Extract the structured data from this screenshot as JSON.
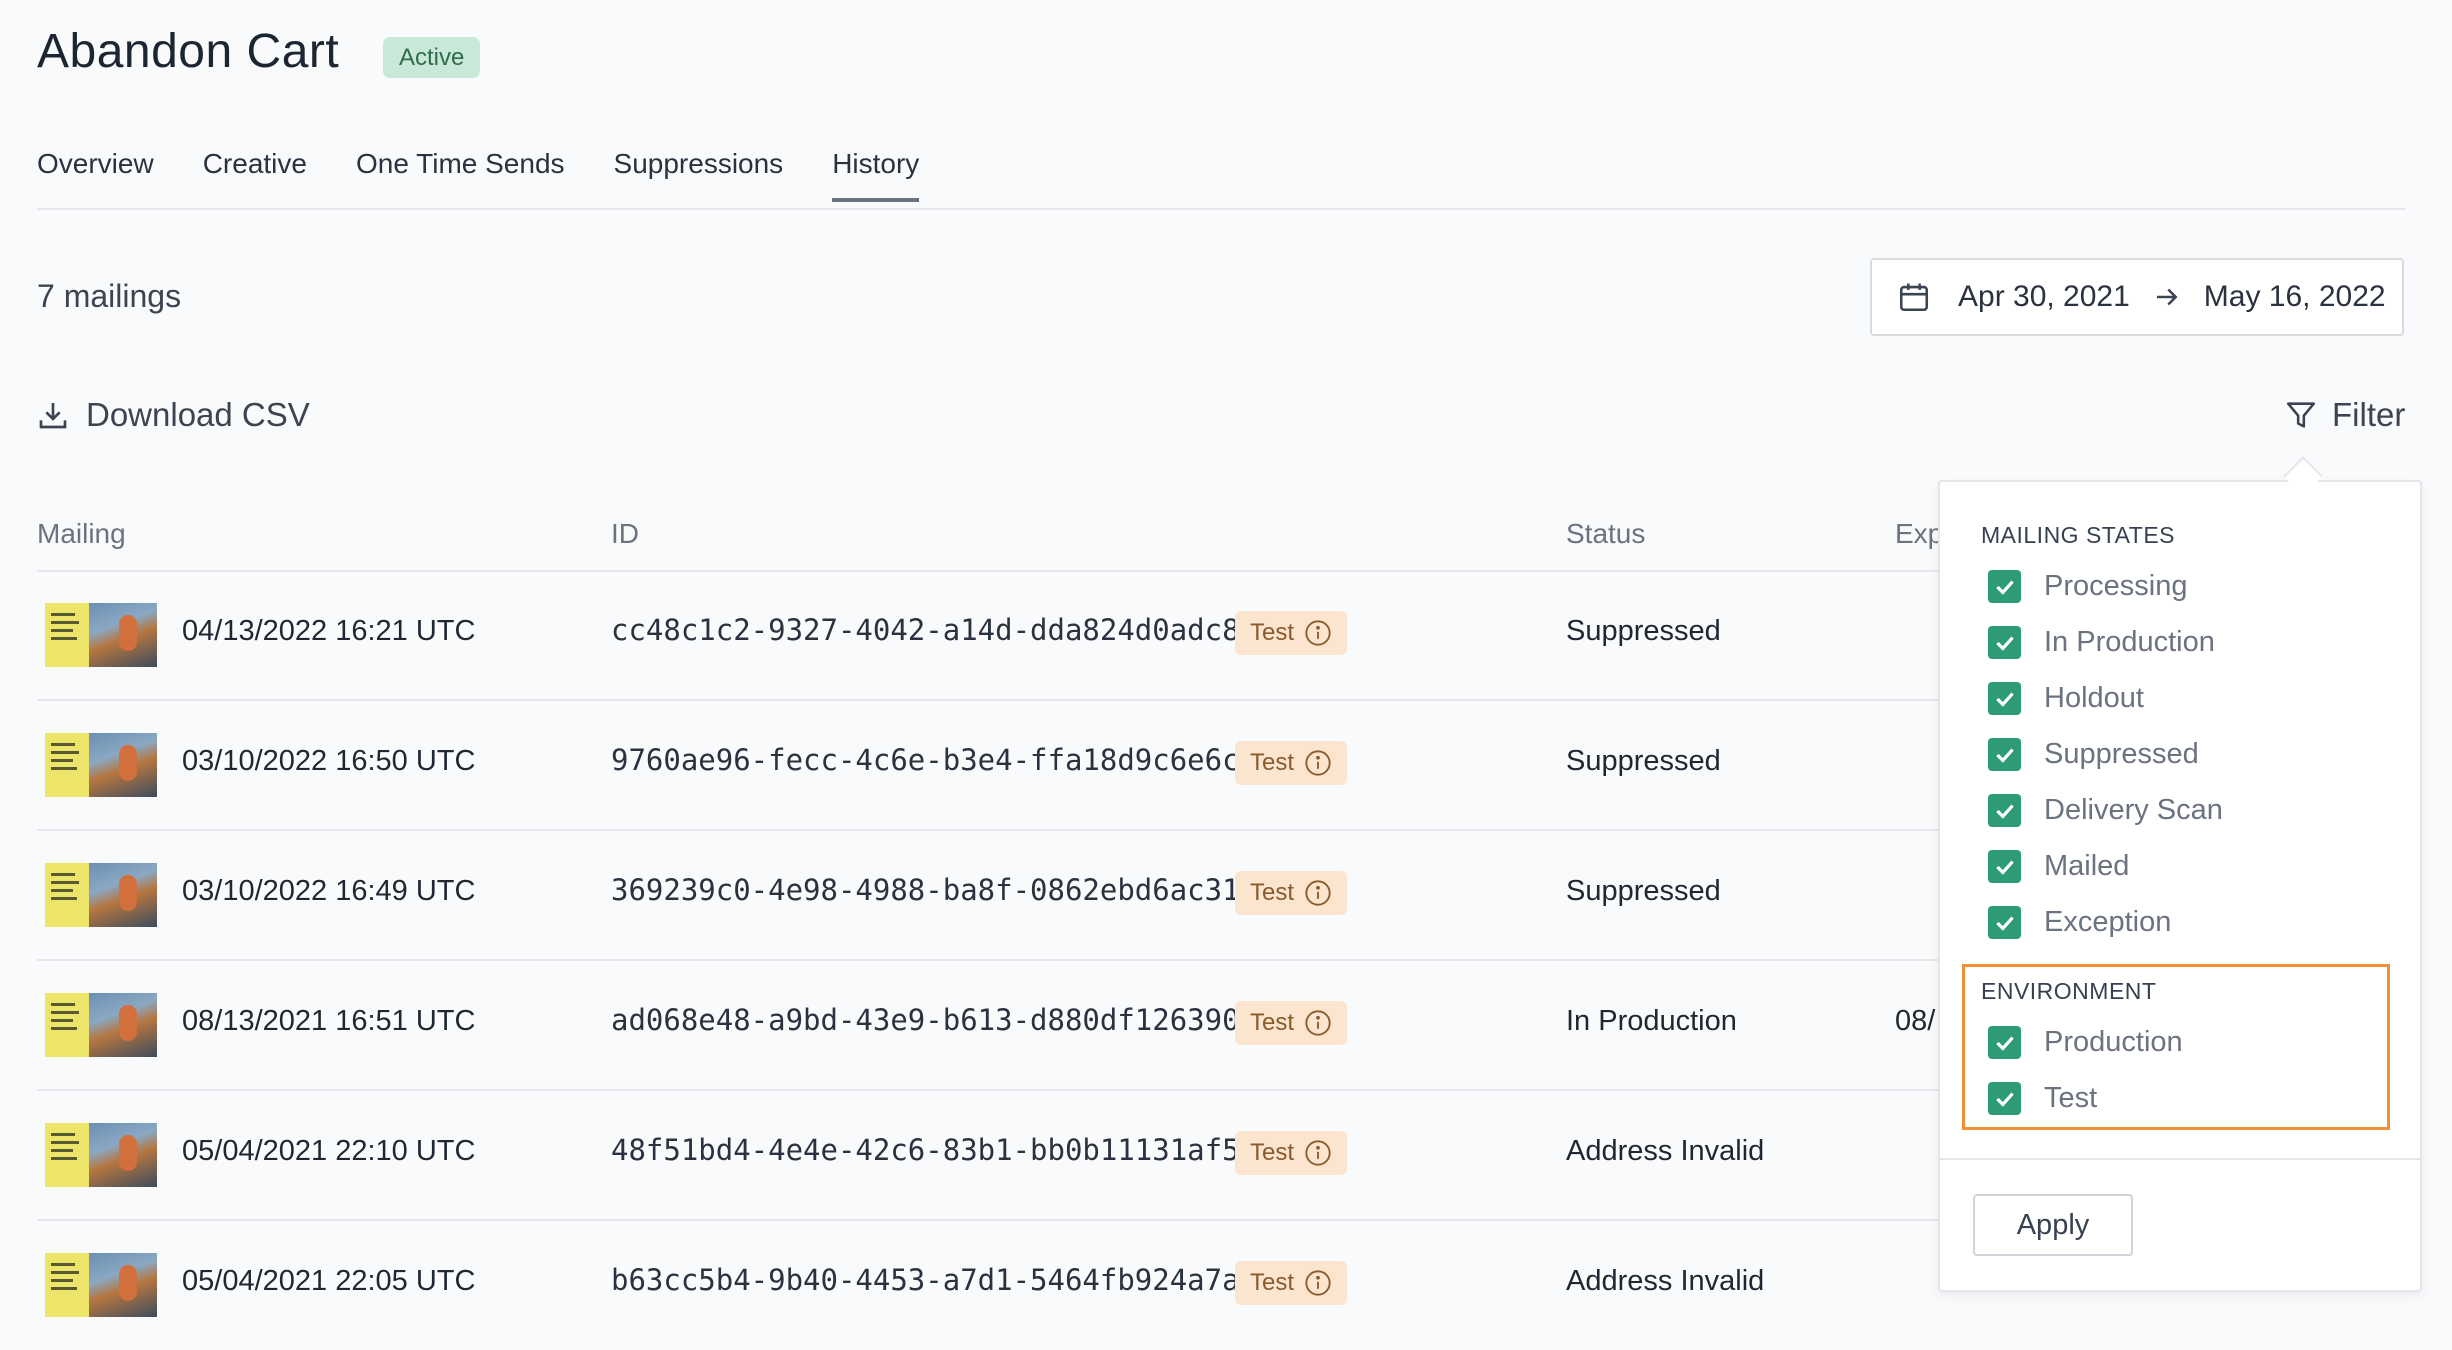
{
  "header": {
    "title": "Abandon Cart",
    "status_badge": "Active"
  },
  "tabs": [
    {
      "label": "Overview",
      "active": false
    },
    {
      "label": "Creative",
      "active": false
    },
    {
      "label": "One Time Sends",
      "active": false
    },
    {
      "label": "Suppressions",
      "active": false
    },
    {
      "label": "History",
      "active": true
    }
  ],
  "summary": {
    "count_label": "7 mailings"
  },
  "date_range": {
    "start": "Apr 30, 2021",
    "end": "May 16, 2022",
    "icon": "calendar-icon"
  },
  "actions": {
    "download_label": "Download CSV",
    "filter_label": "Filter"
  },
  "table": {
    "columns": [
      "Mailing",
      "ID",
      "Status",
      "Exp"
    ],
    "rows": [
      {
        "date": "04/13/2022 16:21 UTC",
        "id": "cc48c1c2-9327-4042-a14d-dda824d0adc8",
        "badge": "Test",
        "status": "Suppressed",
        "exp": ""
      },
      {
        "date": "03/10/2022 16:50 UTC",
        "id": "9760ae96-fecc-4c6e-b3e4-ffa18d9c6e6c",
        "badge": "Test",
        "status": "Suppressed",
        "exp": ""
      },
      {
        "date": "03/10/2022 16:49 UTC",
        "id": "369239c0-4e98-4988-ba8f-0862ebd6ac31",
        "badge": "Test",
        "status": "Suppressed",
        "exp": ""
      },
      {
        "date": "08/13/2021 16:51 UTC",
        "id": "ad068e48-a9bd-43e9-b613-d880df126390",
        "badge": "Test",
        "status": "In Production",
        "exp": "08/"
      },
      {
        "date": "05/04/2021 22:10 UTC",
        "id": "48f51bd4-4e4e-42c6-83b1-bb0b11131af5",
        "badge": "Test",
        "status": "Address Invalid",
        "exp": ""
      },
      {
        "date": "05/04/2021 22:05 UTC",
        "id": "b63cc5b4-9b40-4453-a7d1-5464fb924a7a",
        "badge": "Test",
        "status": "Address Invalid",
        "exp": ""
      }
    ]
  },
  "filter_panel": {
    "mailing_states_heading": "MAILING STATES",
    "mailing_states": [
      "Processing",
      "In Production",
      "Holdout",
      "Suppressed",
      "Delivery Scan",
      "Mailed",
      "Exception"
    ],
    "environment_heading": "ENVIRONMENT",
    "environment": [
      "Production",
      "Test"
    ],
    "apply_label": "Apply",
    "highlight_color": "#f0913a"
  },
  "colors": {
    "badge_active_bg": "#c8e9d8",
    "test_badge_bg": "#fbe5cf",
    "checkbox": "#2d9b74"
  }
}
